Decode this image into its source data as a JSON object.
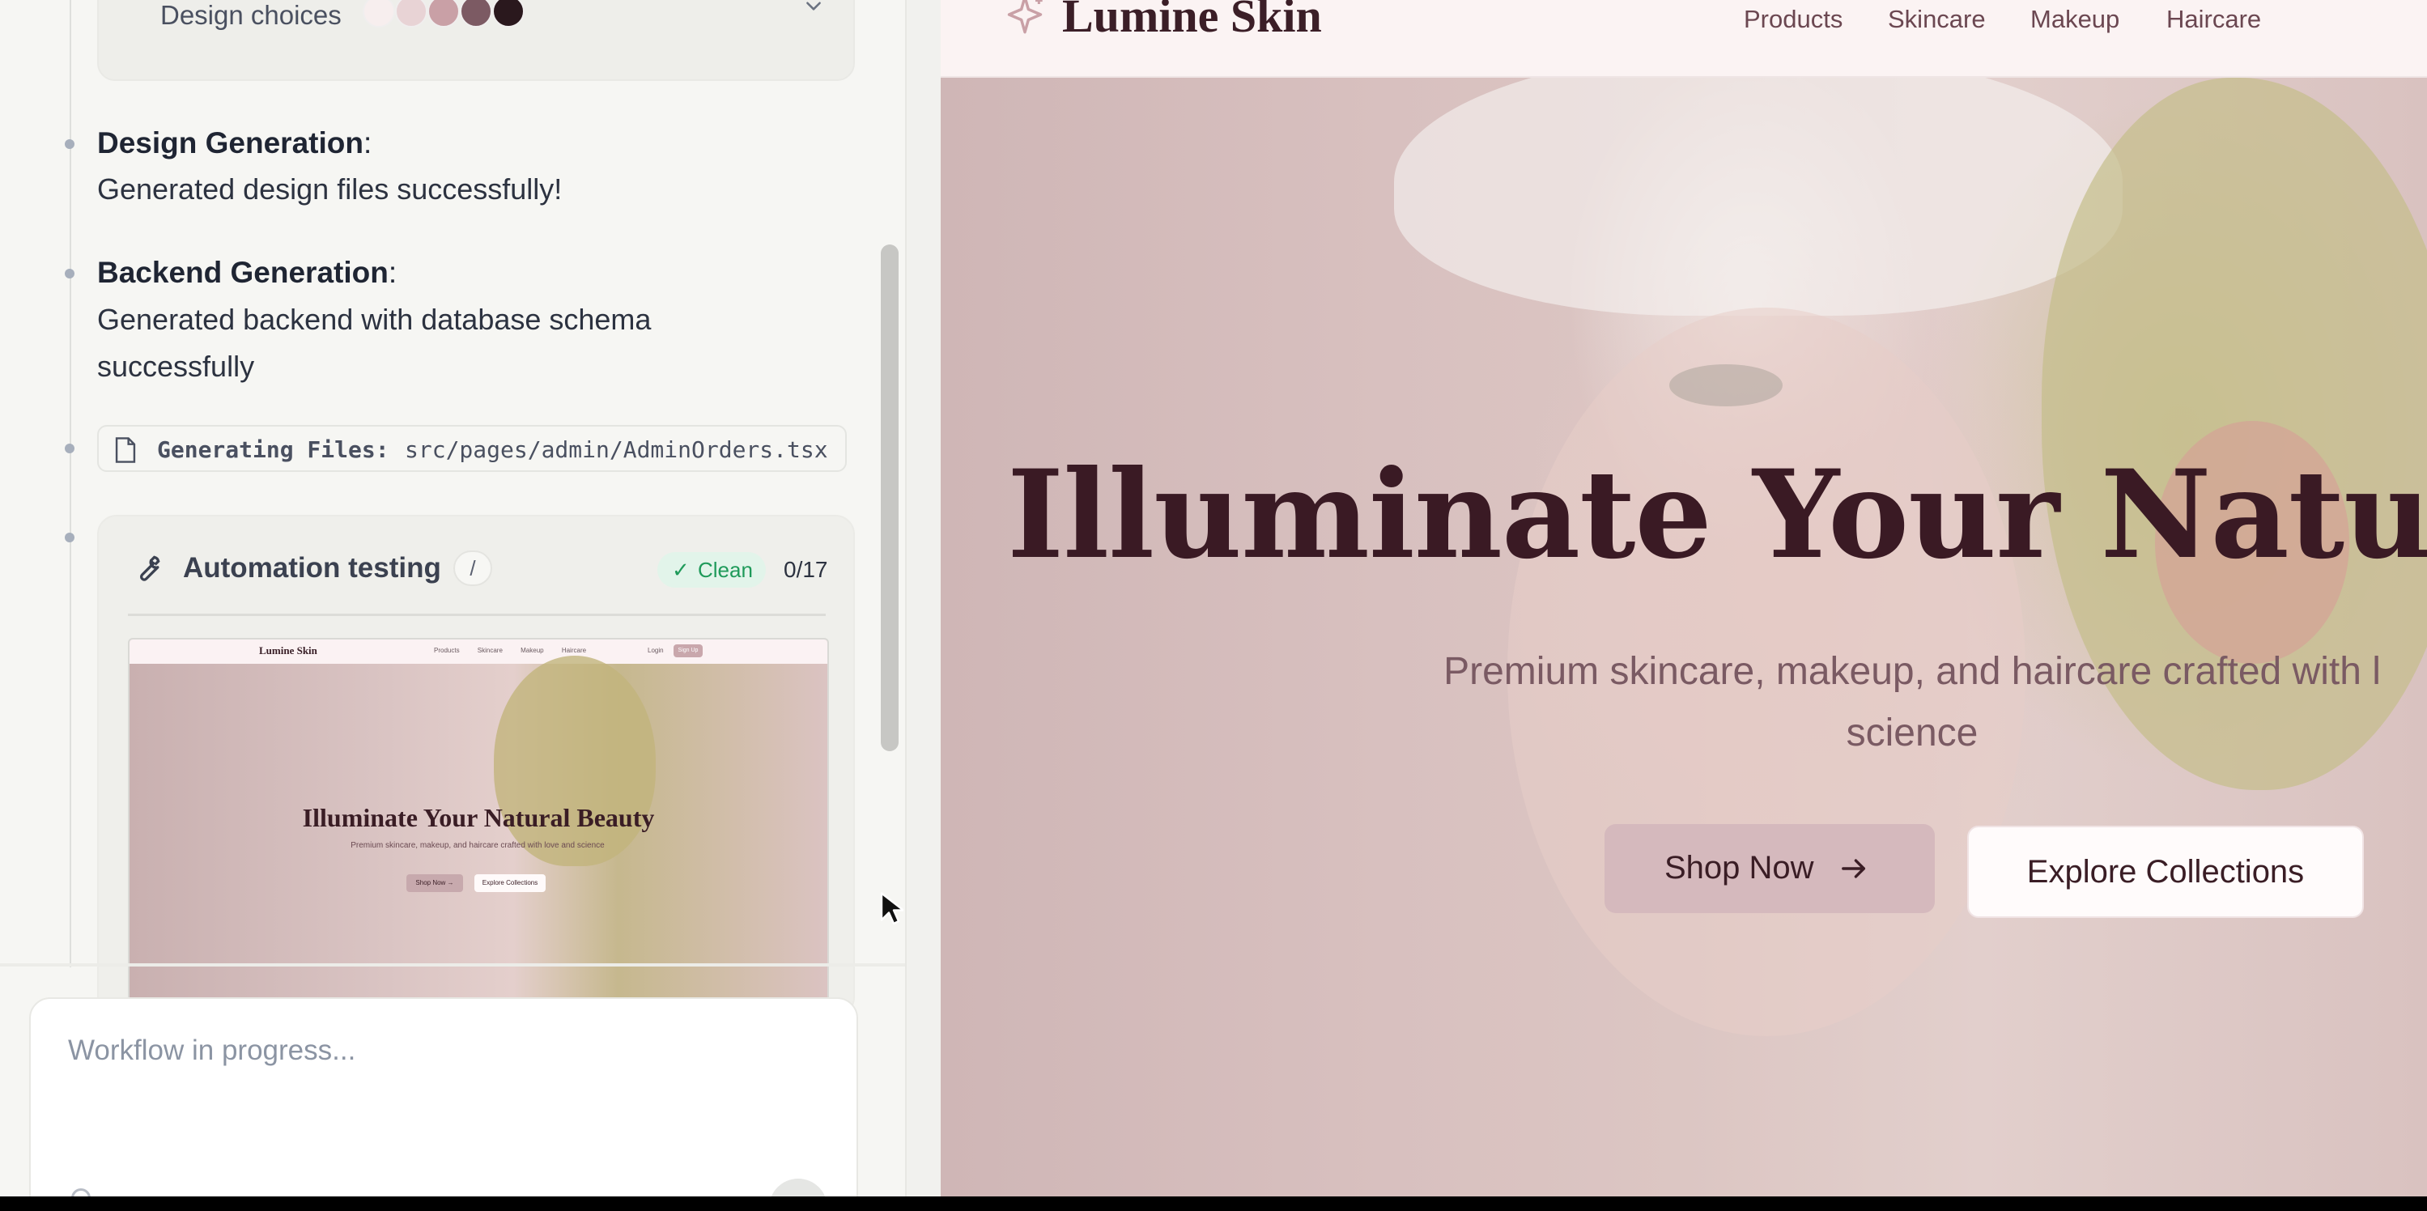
{
  "workflow": {
    "design_choices": {
      "label": "Design choices",
      "swatches": [
        "#f7eeee",
        "#e8d3d5",
        "#c9a0a6",
        "#7c5a63",
        "#2a181d"
      ]
    },
    "steps": [
      {
        "title": "Design Generation",
        "suffix": ":",
        "body": "Generated design files successfully!"
      },
      {
        "title": "Backend Generation",
        "suffix": ":",
        "body_line1": "Generated backend with database schema",
        "body_line2": "successfully"
      }
    ],
    "generating_files": {
      "label": "Generating Files:",
      "path": "src/pages/admin/AdminOrders.tsx"
    },
    "automation": {
      "title": "Automation testing",
      "slash": "/",
      "badge": "Clean",
      "count": "0/17",
      "thumbnail": {
        "logo": "Lumine Skin",
        "nav_links": "Products Skincare Makeup Haircare",
        "login": "Login",
        "signup": "Sign Up",
        "title": "Illuminate Your Natural Beauty",
        "subtitle": "Premium skincare, makeup, and haircare crafted with love and science",
        "shop": "Shop Now →",
        "explore": "Explore Collections"
      }
    },
    "composer": {
      "placeholder": "Workflow in progress..."
    }
  },
  "preview": {
    "brand": "Lumine Skin",
    "nav": [
      "Products",
      "Skincare",
      "Makeup",
      "Haircare"
    ],
    "hero_title": "Illuminate Your Natura",
    "hero_subtitle_line1": "Premium skincare, makeup, and haircare crafted with l",
    "hero_subtitle_line2": "science",
    "shop_button": "Shop Now",
    "explore_button": "Explore Collections"
  }
}
